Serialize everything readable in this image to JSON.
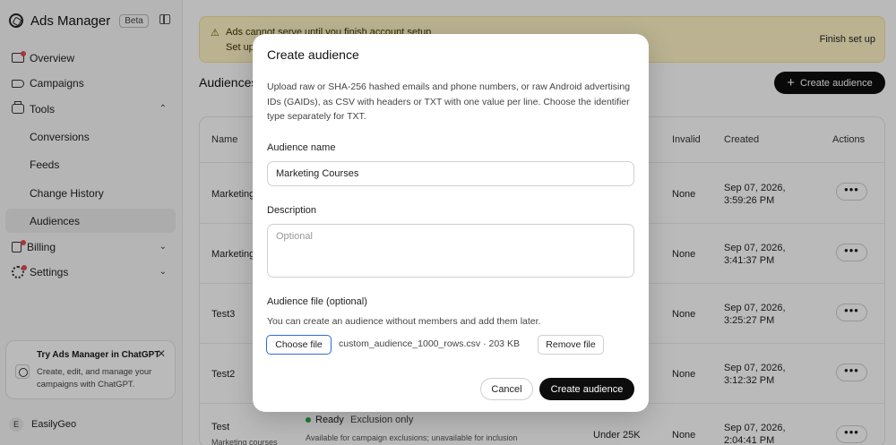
{
  "app": {
    "name": "Ads Manager",
    "badge": "Beta"
  },
  "sidebar": {
    "items": [
      {
        "label": "Overview"
      },
      {
        "label": "Campaigns"
      },
      {
        "label": "Tools"
      },
      {
        "label": "Conversions"
      },
      {
        "label": "Feeds"
      },
      {
        "label": "Change History"
      },
      {
        "label": "Audiences"
      },
      {
        "label": "Billing"
      },
      {
        "label": "Settings"
      }
    ],
    "promo": {
      "title": "Try Ads Manager in ChatGPT",
      "body": "Create, edit, and manage your campaigns with ChatGPT."
    },
    "user": {
      "initial": "E",
      "name": "EasilyGeo"
    }
  },
  "banner": {
    "title": "Ads cannot serve until you finish account setup",
    "sub": "Set up",
    "action": "Finish set up"
  },
  "page": {
    "title": "Audiences",
    "create_button": "Create audience"
  },
  "table": {
    "headers": {
      "name": "Name",
      "invalid": "Invalid",
      "created": "Created",
      "actions": "Actions"
    },
    "rows": [
      {
        "name": "Marketing",
        "invalid": "None",
        "created_date": "Sep 07, 2026,",
        "created_time": "3:59:26 PM"
      },
      {
        "name": "Marketing",
        "invalid": "None",
        "created_date": "Sep 07, 2026,",
        "created_time": "3:41:37 PM"
      },
      {
        "name": "Test3",
        "invalid": "None",
        "created_date": "Sep 07, 2026,",
        "created_time": "3:25:27 PM"
      },
      {
        "name": "Test2",
        "invalid": "None",
        "created_date": "Sep 07, 2026,",
        "created_time": "3:12:32 PM"
      },
      {
        "name": "Test",
        "sub": "Marketing courses",
        "status": "Ready",
        "status_detail": "Exclusion only",
        "status_note": "Available for campaign exclusions; unavailable for inclusion",
        "size": "Under 25K",
        "invalid": "None",
        "created_date": "Sep 07, 2026,",
        "created_time": "2:04:41 PM"
      }
    ],
    "menu_glyph": "•••"
  },
  "modal": {
    "title": "Create audience",
    "description": "Upload raw or SHA-256 hashed emails and phone numbers, or raw Android advertising IDs (GAIDs), as CSV with headers or TXT with one value per line. Choose the identifier type separately for TXT.",
    "name_label": "Audience name",
    "name_value": "Marketing Courses",
    "description_label": "Description",
    "description_placeholder": "Optional",
    "file_label": "Audience file (optional)",
    "file_helper": "You can create an audience without members and add them later.",
    "choose_file": "Choose file",
    "file_name": "custom_audience_1000_rows.csv · 203 KB",
    "remove_file": "Remove file",
    "cancel": "Cancel",
    "submit": "Create audience"
  }
}
